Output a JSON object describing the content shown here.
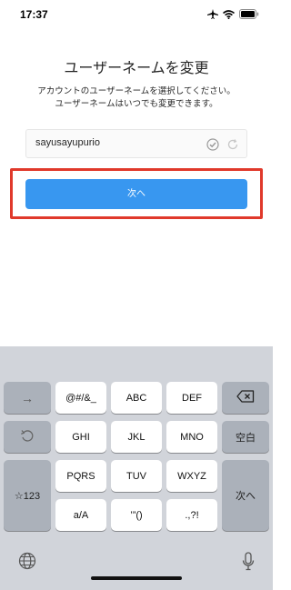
{
  "status_bar": {
    "time": "17:37"
  },
  "screen": {
    "title": "ユーザーネームを変更",
    "description_line1": "アカウントのユーザーネームを選択してください。",
    "description_line2": "ユーザーネームはいつでも変更できます。"
  },
  "username_field": {
    "value": "sayusayupurio"
  },
  "next_button": {
    "label": "次へ"
  },
  "colors": {
    "accent": "#3897f0",
    "highlight": "#e0392b"
  },
  "keyboard": {
    "row1": [
      "@#/&_",
      "ABC",
      "DEF"
    ],
    "row2": [
      "GHI",
      "JKL",
      "MNO"
    ],
    "row3": [
      "PQRS",
      "TUV",
      "WXYZ"
    ],
    "row4": [
      "a/A",
      "’”()",
      ".,?!"
    ],
    "left_keys": [
      "→",
      "☆123"
    ],
    "right_keys": [
      "空白",
      "次へ"
    ],
    "icons": [
      "arrow-right-icon",
      "undo-icon",
      "backspace-icon",
      "globe-icon",
      "mic-icon"
    ]
  }
}
